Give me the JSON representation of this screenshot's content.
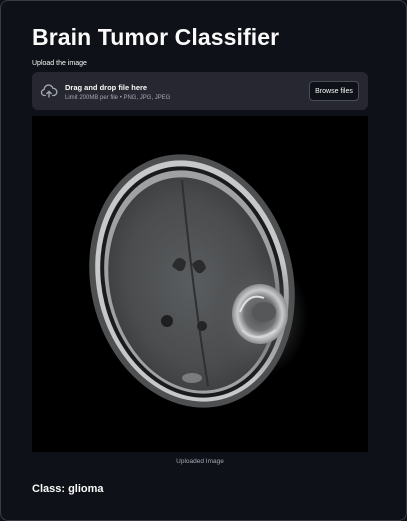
{
  "app": {
    "title": "Brain Tumor Classifier"
  },
  "uploader": {
    "label": "Upload the image",
    "drop_text": "Drag and drop file here",
    "limit_text": "Limit 200MB per file • PNG, JPG, JPEG",
    "browse_label": "Browse files",
    "icon": "cloud-upload-icon"
  },
  "image": {
    "caption": "Uploaded Image"
  },
  "result": {
    "text": "Class: glioma"
  },
  "colors": {
    "background": "#0e1117",
    "dropzone": "#262730",
    "text": "#fafafa",
    "muted": "#a3a8b4"
  }
}
